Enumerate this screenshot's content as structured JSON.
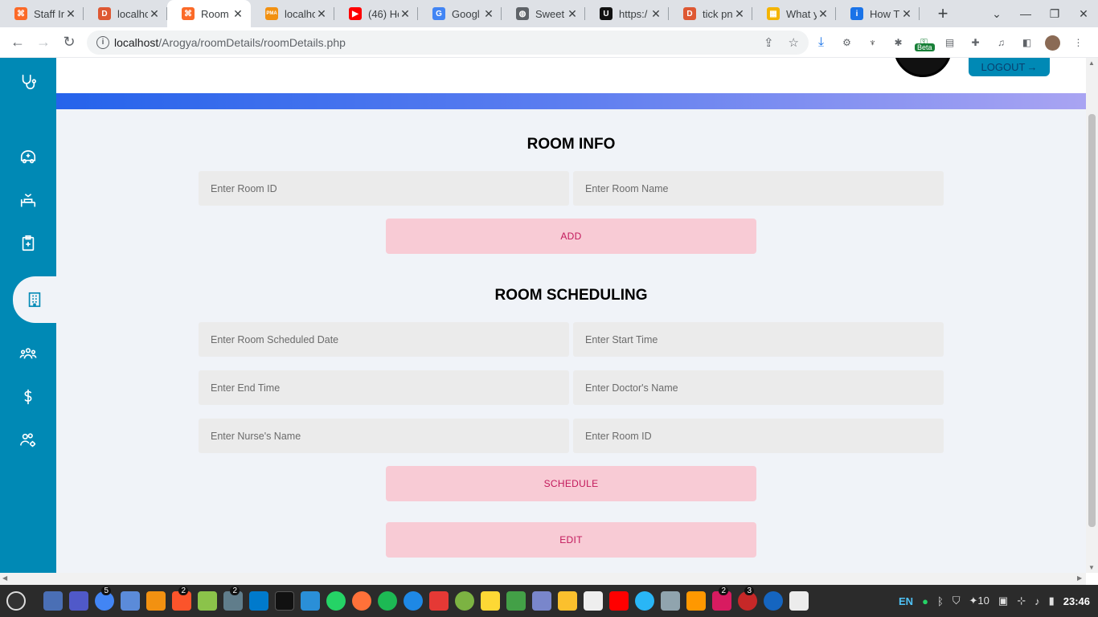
{
  "browser": {
    "tabs": [
      {
        "label": "Staff In",
        "favicon_color": "#fb6a28",
        "favicon_glyph": "⌘",
        "active": false
      },
      {
        "label": "localho",
        "favicon_color": "#de5833",
        "favicon_glyph": "D",
        "active": false
      },
      {
        "label": "Room",
        "favicon_color": "#fb6a28",
        "favicon_glyph": "⌘",
        "active": true
      },
      {
        "label": "localho",
        "favicon_color": "#f29111",
        "favicon_glyph": "PMA",
        "active": false
      },
      {
        "label": "(46) Ho",
        "favicon_color": "#ff0000",
        "favicon_glyph": "▶",
        "active": false
      },
      {
        "label": "Googl",
        "favicon_color": "#4285f4",
        "favicon_glyph": "G",
        "active": false
      },
      {
        "label": "Sweet",
        "favicon_color": "#5f6368",
        "favicon_glyph": "◍",
        "active": false
      },
      {
        "label": "https:/",
        "favicon_color": "#111111",
        "favicon_glyph": "U",
        "active": false
      },
      {
        "label": "tick pn",
        "favicon_color": "#de5833",
        "favicon_glyph": "D",
        "active": false
      },
      {
        "label": "What y",
        "favicon_color": "#f4b400",
        "favicon_glyph": "▦",
        "active": false
      },
      {
        "label": "How T",
        "favicon_color": "#1a73e8",
        "favicon_glyph": "i",
        "active": false
      }
    ],
    "url_host": "localhost",
    "url_path": "/Arogya/roomDetails/roomDetails.php",
    "beta_label": "Beta"
  },
  "header": {
    "logout_label": "LOGOUT",
    "logout_arrow": "→"
  },
  "sidebar": {
    "items": [
      {
        "name": "stethoscope-icon",
        "active": false
      },
      {
        "name": "ambulance-icon",
        "active": false
      },
      {
        "name": "hospital-bed-icon",
        "active": false
      },
      {
        "name": "clipboard-plus-icon",
        "active": false
      },
      {
        "name": "building-icon",
        "active": true
      },
      {
        "name": "people-group-icon",
        "active": false
      },
      {
        "name": "dollar-icon",
        "active": false
      },
      {
        "name": "users-gear-icon",
        "active": false
      }
    ]
  },
  "room_info": {
    "title": "ROOM INFO",
    "room_id_placeholder": "Enter Room ID",
    "room_name_placeholder": "Enter Room Name",
    "add_label": "ADD"
  },
  "room_scheduling": {
    "title": "ROOM SCHEDULING",
    "date_placeholder": "Enter Room Scheduled Date",
    "start_placeholder": "Enter Start Time",
    "end_placeholder": "Enter End Time",
    "doctor_placeholder": "Enter Doctor's Name",
    "nurse_placeholder": "Enter Nurse's Name",
    "room_id_placeholder": "Enter Room ID",
    "schedule_label": "SCHEDULE",
    "edit_label": "EDIT"
  },
  "taskbar": {
    "badges": {
      "chrome": "5",
      "brave": "2",
      "editor": "2",
      "mail": "2",
      "glasses": "3"
    },
    "lang": "EN",
    "volume_level": "10",
    "clock": "23:46"
  },
  "colors": {
    "sidebar": "#0089b5",
    "button_bg": "#f8cbd5",
    "button_text": "#c2185b"
  }
}
